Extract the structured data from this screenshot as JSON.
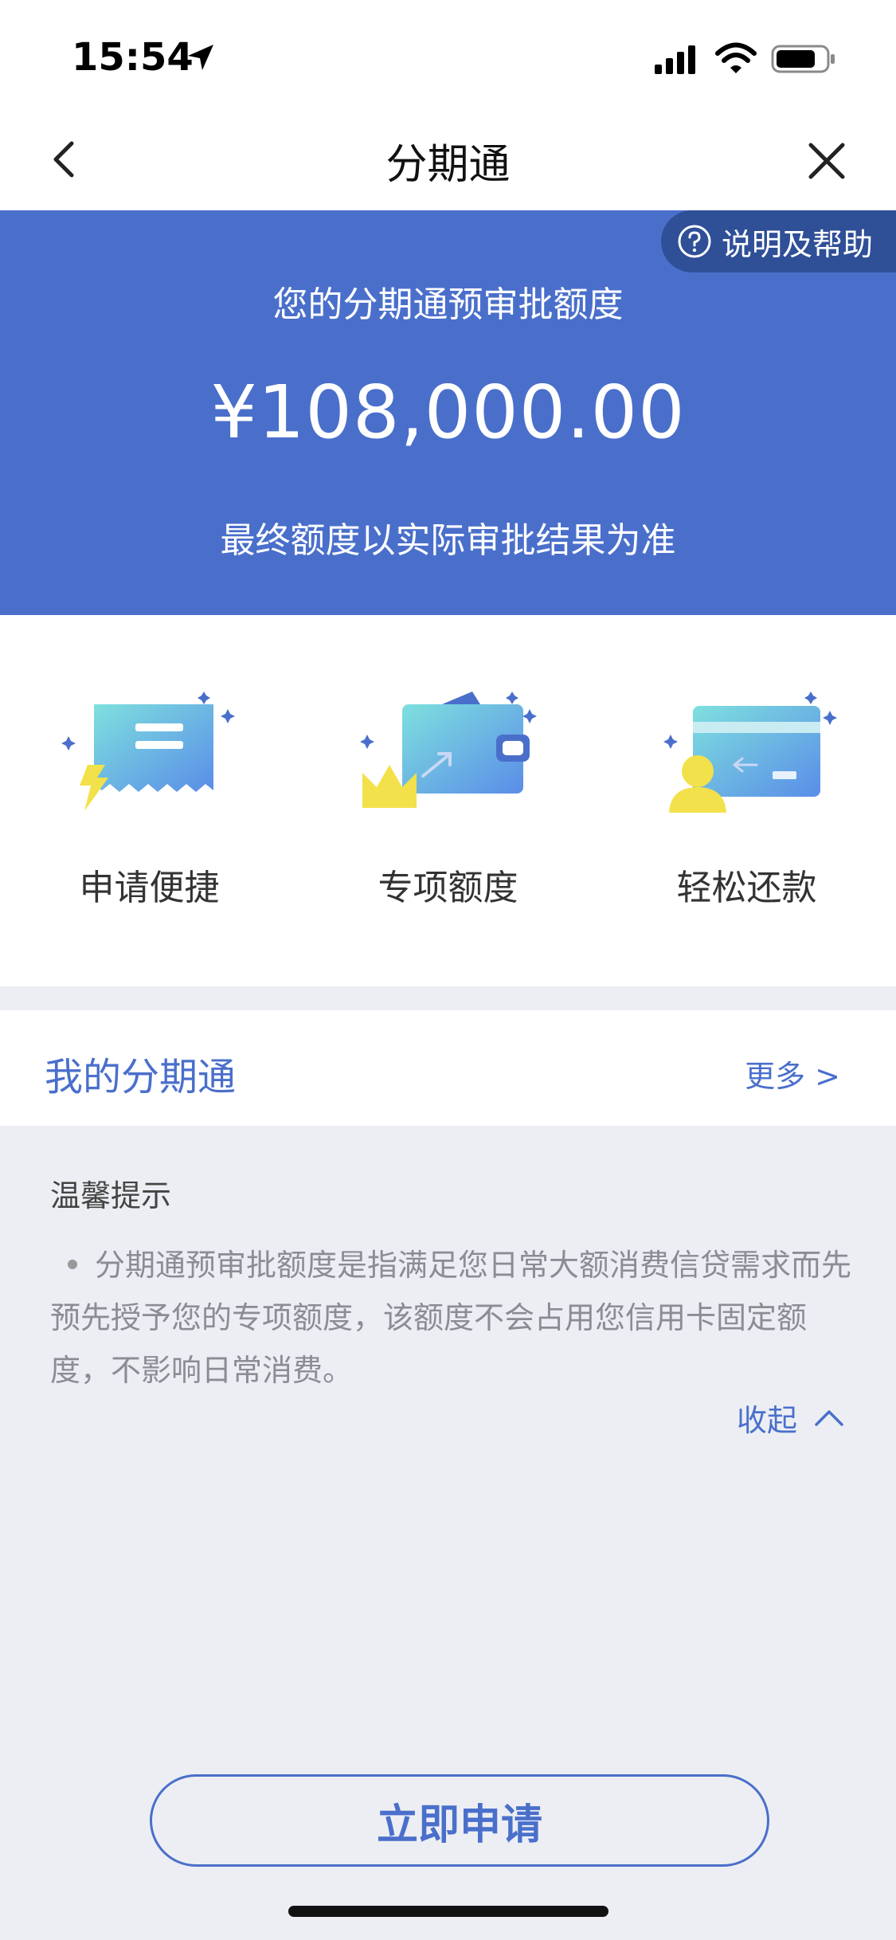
{
  "status_bar": {
    "time": "15:54"
  },
  "nav": {
    "title": "分期通"
  },
  "hero": {
    "help_label": "说明及帮助",
    "caption": "您的分期通预审批额度",
    "amount": "¥108,000.00",
    "note": "最终额度以实际审批结果为准"
  },
  "features": [
    {
      "label": "申请便捷",
      "icon": "receipt-lightning-icon"
    },
    {
      "label": "专项额度",
      "icon": "wallet-crown-icon"
    },
    {
      "label": "轻松还款",
      "icon": "card-user-icon"
    }
  ],
  "my_section": {
    "title": "我的分期通",
    "more_label": "更多 >"
  },
  "tips": {
    "title": "温馨提示",
    "body": "分期通预审批额度是指满足您日常大额消费信贷需求而先预先授予您的专项额度，该额度不会占用您信用卡固定额度，不影响日常消费。",
    "collapse_label": "收起"
  },
  "apply_button": {
    "label": "立即申请"
  },
  "colors": {
    "accent": "#4a6fcb",
    "help_pill": "#2f4f97",
    "background": "#eceef3"
  }
}
